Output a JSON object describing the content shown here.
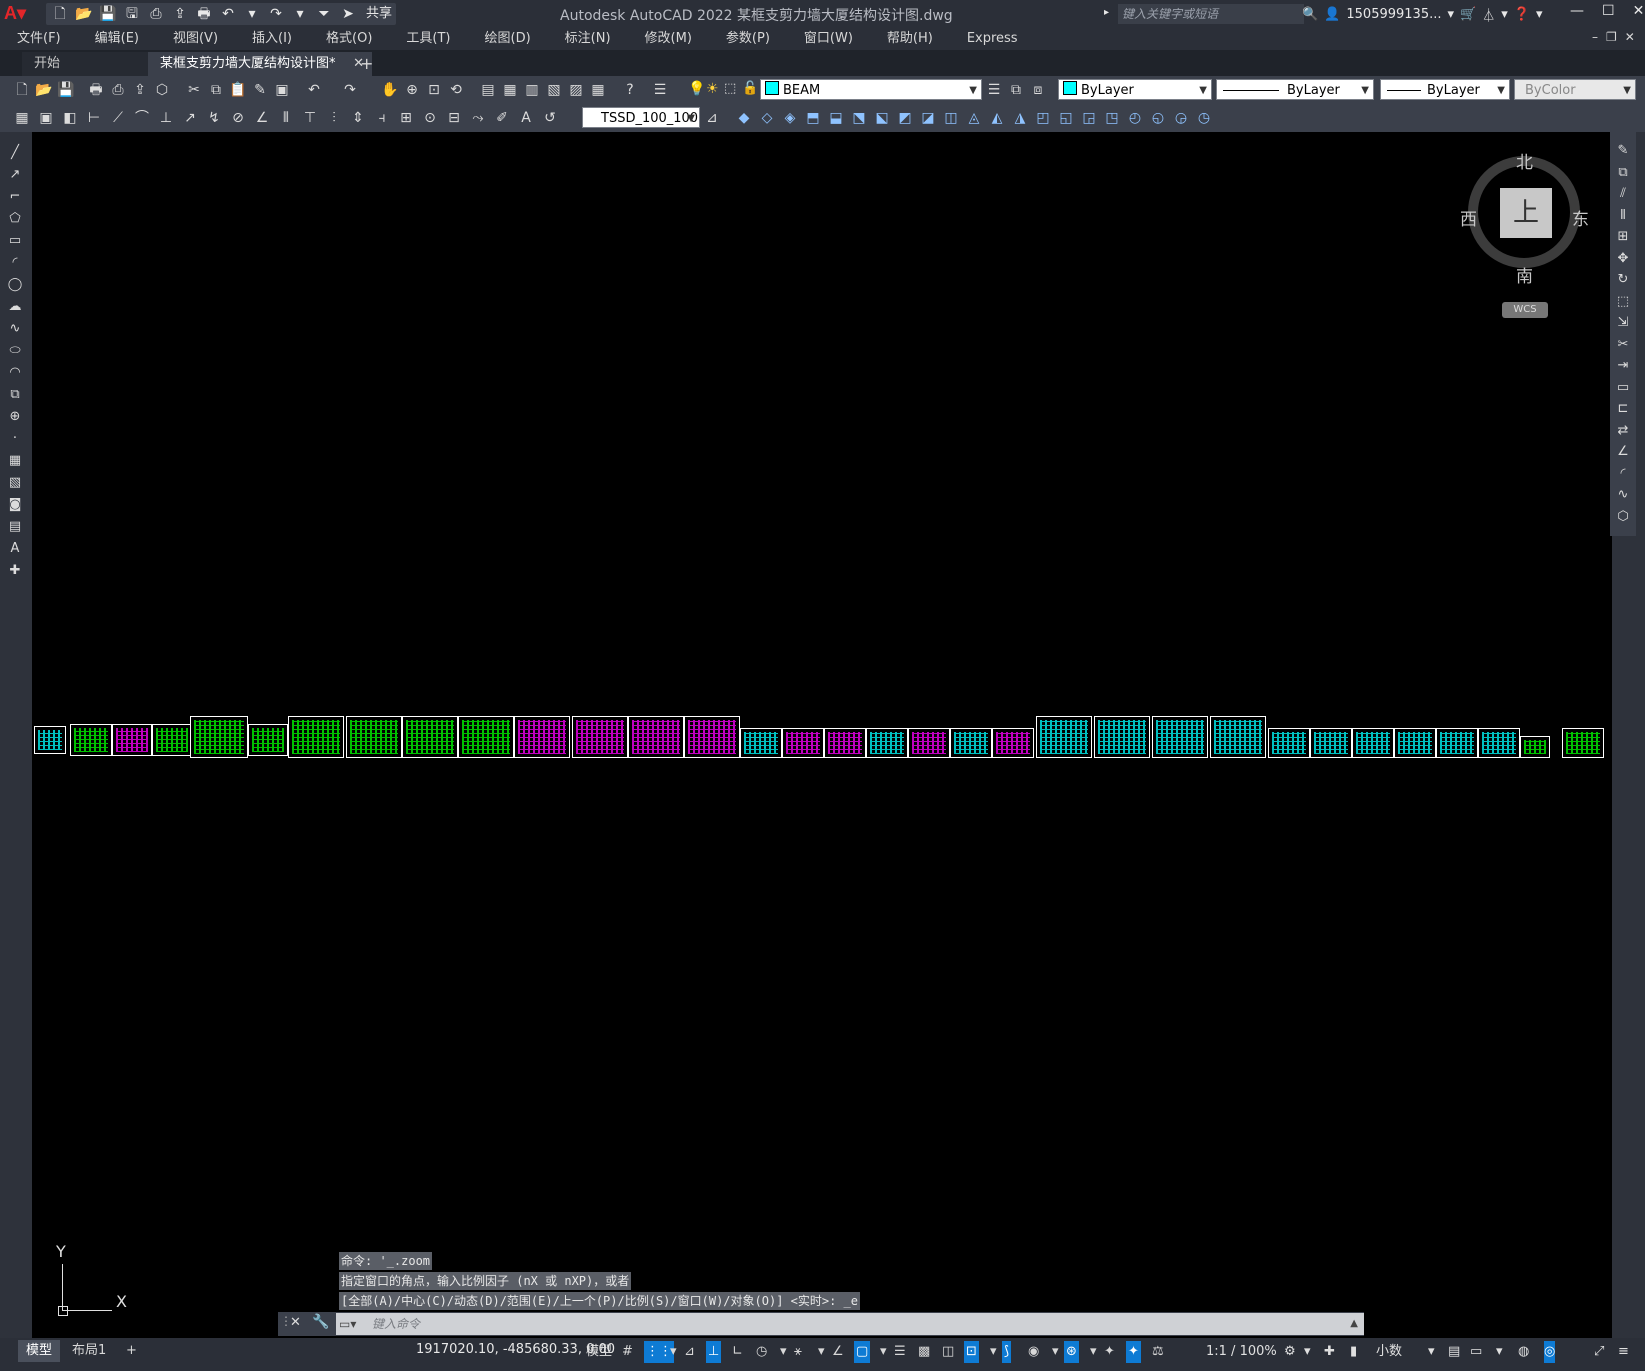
{
  "window": {
    "title": "Autodesk AutoCAD 2022    某框支剪力墙大厦结构设计图.dwg",
    "search_placeholder": "键入关键字或短语",
    "user": "1505999135...",
    "share_label": "共享"
  },
  "menu": [
    "文件(F)",
    "编辑(E)",
    "视图(V)",
    "插入(I)",
    "格式(O)",
    "工具(T)",
    "绘图(D)",
    "标注(N)",
    "修改(M)",
    "参数(P)",
    "窗口(W)",
    "帮助(H)",
    "Express"
  ],
  "tabs": {
    "start": "开始",
    "doc": "某框支剪力墙大厦结构设计图*",
    "close": "✕",
    "add": "+"
  },
  "properties": {
    "layer": "BEAM",
    "color": "ByLayer",
    "linetype": "ByLayer",
    "lineweight": "ByLayer",
    "plotstyle": "ByColor",
    "dimstyle": "TSSD_100_100",
    "layer_color": "#00ffff"
  },
  "viewcube": {
    "north": "北",
    "south": "南",
    "east": "东",
    "west": "西",
    "face": "上",
    "wcs": "WCS"
  },
  "ucs": {
    "x": "X",
    "y": "Y"
  },
  "command": {
    "history": [
      "命令: '_.zoom",
      "指定窗口的角点，输入比例因子 (nX 或 nXP)，或者",
      "[全部(A)/中心(C)/动态(D)/范围(E)/上一个(P)/比例(S)/窗口(W)/对象(O)] <实时>: _e"
    ],
    "placeholder": "键入命令"
  },
  "status": {
    "layouts": [
      "模型",
      "布局1"
    ],
    "add_layout": "+",
    "coords": "1917020.10, -485680.33, 0.00",
    "space": "模型",
    "scale": "1:1 / 100%",
    "units": "小数"
  },
  "colors": {
    "accent": "#0e7bd4",
    "drawing_cyan": "#00ffff",
    "drawing_green": "#00ff00",
    "drawing_magenta": "#ff00ff"
  }
}
